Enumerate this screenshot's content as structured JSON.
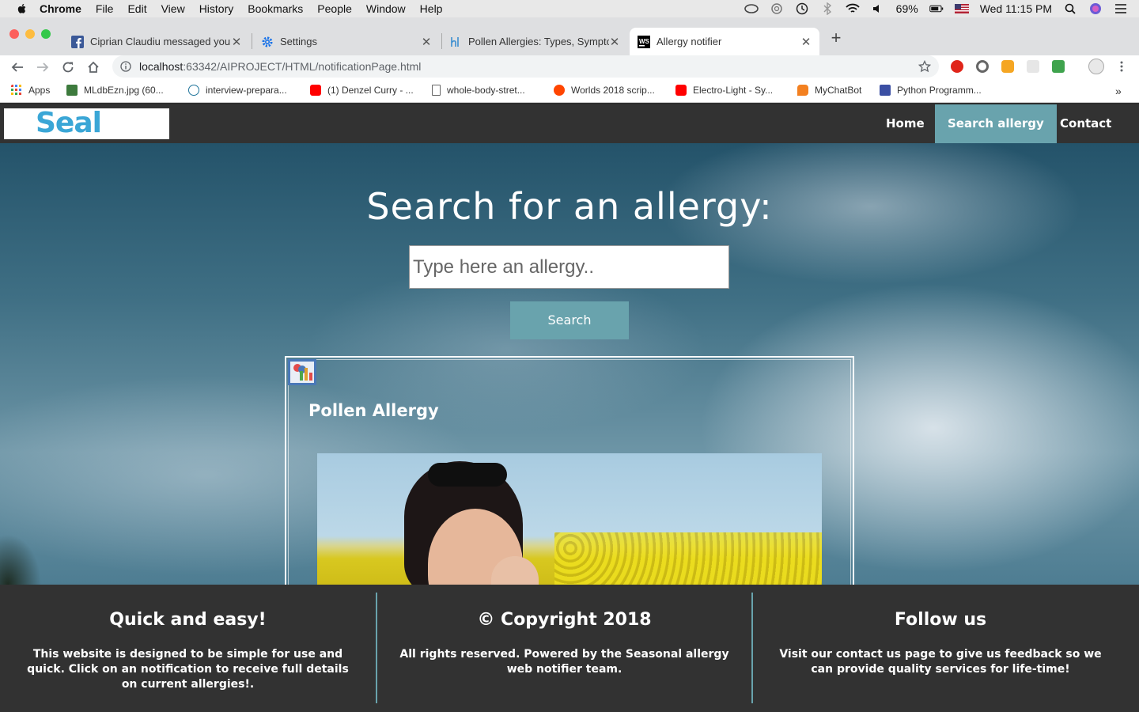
{
  "menubar": {
    "app": "Chrome",
    "items": [
      "File",
      "Edit",
      "View",
      "History",
      "Bookmarks",
      "People",
      "Window",
      "Help"
    ],
    "battery": "69%",
    "clock": "Wed 11:15 PM"
  },
  "tabs": [
    {
      "label": "Ciprian Claudiu messaged you",
      "icon": "facebook-icon"
    },
    {
      "label": "Settings",
      "icon": "settings-gear-icon"
    },
    {
      "label": "Pollen Allergies: Types, Sympto",
      "icon": "healthline-icon"
    },
    {
      "label": "Allergy notifier",
      "icon": "webstorm-icon"
    }
  ],
  "address": {
    "host": "localhost",
    "path": ":63342/AIPROJECT/HTML/notificationPage.html"
  },
  "bookmarks": [
    {
      "label": "Apps",
      "icon": "apps-grid-icon"
    },
    {
      "label": "MLdbEzn.jpg (60...",
      "icon": "image-icon"
    },
    {
      "label": "interview-prepara...",
      "icon": "wordpress-icon"
    },
    {
      "label": "(1) Denzel Curry - ...",
      "icon": "youtube-icon"
    },
    {
      "label": "whole-body-stret...",
      "icon": "document-icon"
    },
    {
      "label": "Worlds 2018 scrip...",
      "icon": "reddit-icon"
    },
    {
      "label": "Electro-Light - Sy...",
      "icon": "youtube-icon"
    },
    {
      "label": "MyChatBot",
      "icon": "chatbot-icon"
    },
    {
      "label": "Python Programm...",
      "icon": "site-icon"
    }
  ],
  "site": {
    "logo": "Seal",
    "nav": [
      "Home",
      "Search allergy",
      "Contact us"
    ],
    "hero_title": "Search for an allergy:",
    "search_placeholder": "Type here an allergy..",
    "search_button": "Search",
    "card": {
      "title": "Pollen Allergy",
      "icon": "broken-image-icon",
      "photo": "woman-sneezing-in-rapeseed-field"
    },
    "footer": [
      {
        "title": "Quick and easy!",
        "text": "This website is designed to be simple for use and quick. Click on an notification to receive full details on current allergies!."
      },
      {
        "title": "© Copyright 2018",
        "text": "All rights reserved. Powered by the Seasonal allergy web notifier team."
      },
      {
        "title": "Follow us",
        "text": "Visit our contact us page to give us feedback so we can provide quality services for life-time!"
      }
    ]
  },
  "colors": {
    "accent": "#69a3ad",
    "nav_bg": "#323232",
    "logo": "#3aa6d6"
  }
}
